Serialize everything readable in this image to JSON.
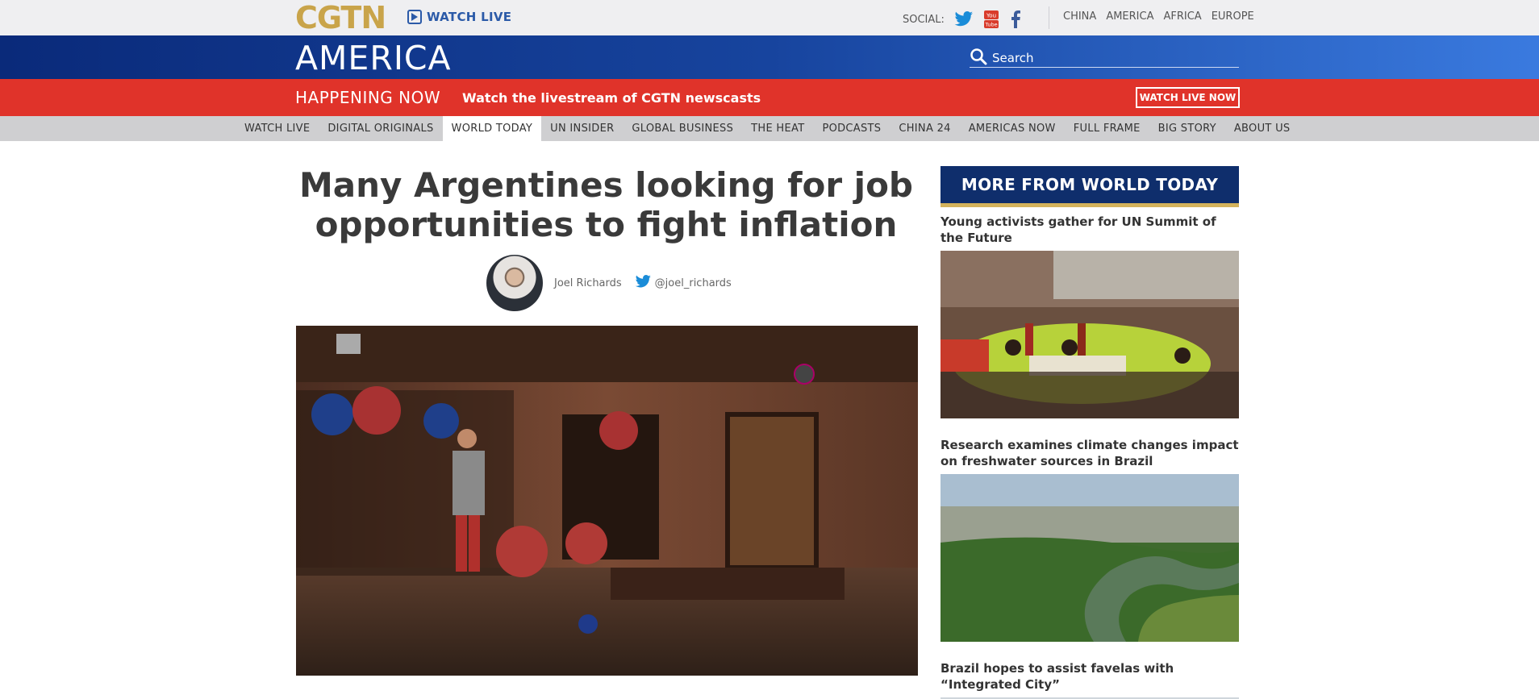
{
  "header": {
    "logo": "CGTN",
    "watch_live": "WATCH LIVE",
    "social_label": "SOCIAL:",
    "social_icons": [
      "twitter-icon",
      "youtube-icon",
      "facebook-icon"
    ],
    "regions": [
      "CHINA",
      "AMERICA",
      "AFRICA",
      "EUROPE"
    ],
    "section_title": "AMERICA",
    "search_placeholder": "Search",
    "colors": {
      "gold": "#c9a44a",
      "blue_dark": "#0a2a7a",
      "blue_light": "#3a7adf",
      "red": "#e0332a",
      "navy": "#0f2e6c"
    }
  },
  "happening": {
    "label": "HAPPENING NOW",
    "text": "Watch the livestream of CGTN newscasts",
    "button": "WATCH LIVE NOW"
  },
  "nav": {
    "items": [
      "WATCH LIVE",
      "DIGITAL ORIGINALS",
      "WORLD TODAY",
      "UN INSIDER",
      "GLOBAL BUSINESS",
      "THE HEAT",
      "PODCASTS",
      "CHINA 24",
      "AMERICAS NOW",
      "FULL FRAME",
      "BIG STORY",
      "ABOUT US"
    ],
    "active": "WORLD TODAY"
  },
  "article": {
    "headline": "Many Argentines looking for job opportunities to fight inflation",
    "author": "Joel Richards",
    "twitter_handle": "@joel_richards"
  },
  "sidebar": {
    "header": "MORE FROM WORLD TODAY",
    "stories": [
      {
        "title": "Young activists gather for UN Summit of the Future"
      },
      {
        "title": "Research examines climate changes impact on freshwater sources in Brazil"
      },
      {
        "title": "Brazil hopes to assist favelas with “Integrated City”"
      }
    ]
  }
}
